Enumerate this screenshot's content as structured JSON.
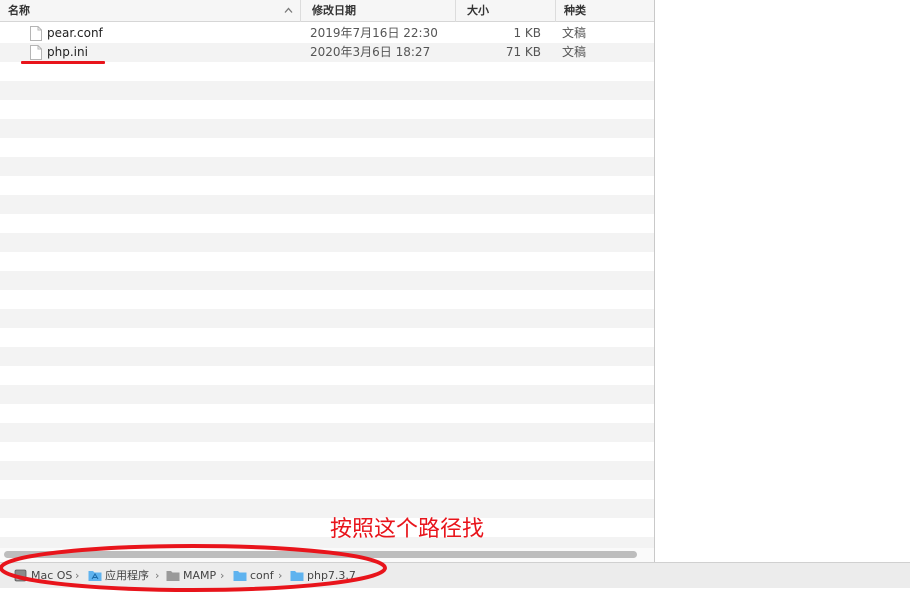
{
  "columns": {
    "name": "名称",
    "date": "修改日期",
    "size": "大小",
    "kind": "种类"
  },
  "files": [
    {
      "name": "pear.conf",
      "date": "2019年7月16日 22:30",
      "size": "1 KB",
      "kind": "文稿"
    },
    {
      "name": "php.ini",
      "date": "2020年3月6日 18:27",
      "size": "71 KB",
      "kind": "文稿"
    }
  ],
  "path": [
    {
      "label": "Mac OS",
      "icon": "hard-drive-icon"
    },
    {
      "label": "应用程序",
      "icon": "applications-folder-icon"
    },
    {
      "label": "MAMP",
      "icon": "folder-icon"
    },
    {
      "label": "conf",
      "icon": "folder-icon"
    },
    {
      "label": "php7.3.7",
      "icon": "folder-icon"
    }
  ],
  "annotation": {
    "text": "按照这个路径找",
    "color": "#e8141b"
  },
  "colors": {
    "folder_blue": "#5fb3ef",
    "stripe": "#f3f3f3"
  }
}
